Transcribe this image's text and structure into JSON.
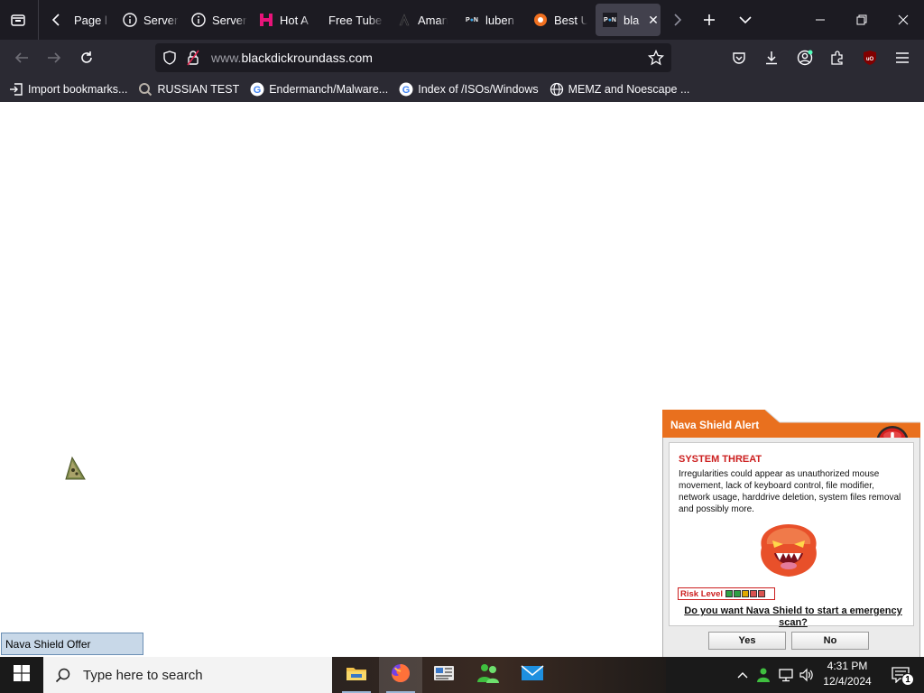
{
  "browser": {
    "tabs": [
      {
        "title": "Page l",
        "favicon": "page-icon"
      },
      {
        "title": "Server",
        "favicon": "info-icon"
      },
      {
        "title": "Server",
        "favicon": "info-icon"
      },
      {
        "title": "Hot A",
        "favicon": "h-logo-icon"
      },
      {
        "title": "Free Tube",
        "favicon": "none"
      },
      {
        "title": "Aman",
        "favicon": "a-logo-icon"
      },
      {
        "title": "luben",
        "favicon": "porn-logo-icon"
      },
      {
        "title": "Best U",
        "favicon": "orange-logo-icon"
      },
      {
        "title": "bla",
        "favicon": "porn-logo-icon",
        "active": true
      }
    ],
    "url": {
      "prefix": "www.",
      "domain": "blackdickroundass.com"
    },
    "bookmarks": [
      {
        "label": "Import bookmarks...",
        "icon": "import-icon"
      },
      {
        "label": "RUSSIAN TEST",
        "icon": "search-icon"
      },
      {
        "label": "Endermanch/Malware...",
        "icon": "google-icon"
      },
      {
        "label": "Index of /ISOs/Windows",
        "icon": "google-icon"
      },
      {
        "label": "MEMZ and Noescape ...",
        "icon": "globe-icon"
      }
    ],
    "accent": "#ff7139"
  },
  "page": {
    "offer_label": "Nava Shield Offer"
  },
  "popup": {
    "title": "Nava Shield Alert",
    "threat_title": "SYSTEM THREAT",
    "threat_text": "Irregularities could appear as unauthorized mouse movement, lack of keyboard control, file modifier, network usage, harddrive deletion, system files removal and possibly more.",
    "risk_label": "Risk Level",
    "risk_colors": [
      "#2ea043",
      "#2ea043",
      "#e0a800",
      "#d9534f",
      "#d9534f"
    ],
    "question": "Do you want Nava Shield to start a emergency scan?",
    "yes_label": "Yes",
    "no_label": "No",
    "header_color": "#e9701e"
  },
  "taskbar": {
    "search_placeholder": "Type here to search",
    "time": "4:31 PM",
    "date": "12/4/2024",
    "notification_count": "1"
  }
}
